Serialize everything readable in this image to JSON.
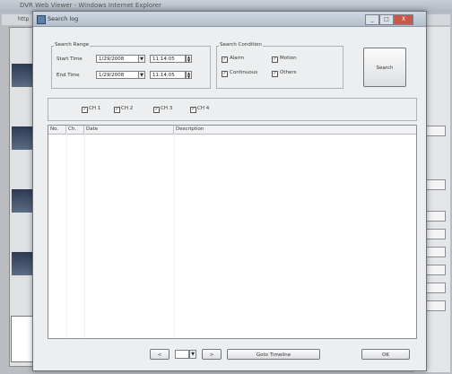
{
  "background_app": {
    "title": "DVR Web Viewer - Windows Internet Explorer",
    "address": "http"
  },
  "dialog": {
    "title": "Search log",
    "window_buttons": {
      "minimize": "_",
      "maximize": "□",
      "close": "X"
    },
    "search_range": {
      "label": "Search Range",
      "start_time_label": "Start Time",
      "start_date": "1/29/2008",
      "start_time": "11:14:05",
      "end_time_label": "End Time",
      "end_date": "1/29/2008",
      "end_time": "11:14:05"
    },
    "search_condition": {
      "label": "Search Condition",
      "options": [
        {
          "label": "Alarm",
          "checked": true
        },
        {
          "label": "Motion",
          "checked": true
        },
        {
          "label": "Continuous",
          "checked": true
        },
        {
          "label": "Others",
          "checked": true
        }
      ]
    },
    "search_button": "Search",
    "channels": [
      {
        "label": "CH 1",
        "checked": true
      },
      {
        "label": "CH 2",
        "checked": true
      },
      {
        "label": "CH 3",
        "checked": true
      },
      {
        "label": "CH 4",
        "checked": true
      }
    ],
    "table": {
      "columns": [
        "No.",
        "Ch.",
        "Date",
        "Description"
      ]
    },
    "footer": {
      "prev": "<",
      "page_select": "",
      "next": ">",
      "goto_timeline": "Goto Timeline",
      "ok": "OK"
    }
  }
}
